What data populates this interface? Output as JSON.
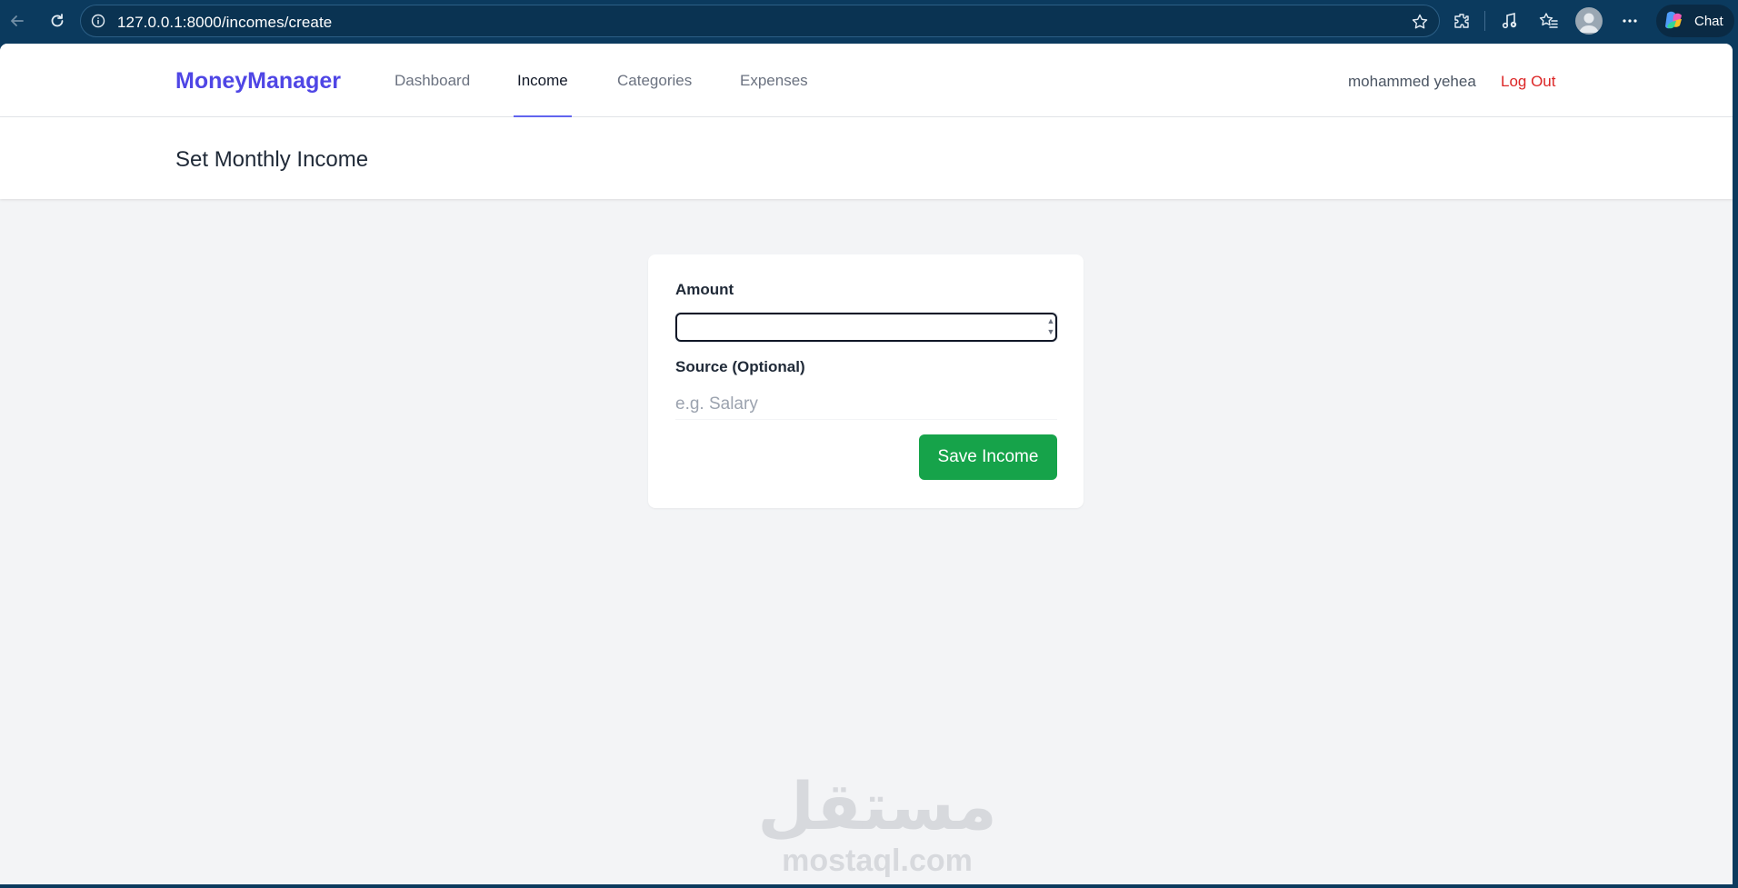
{
  "browser": {
    "url": "127.0.0.1:8000/incomes/create",
    "chat_label": "Chat",
    "icons": {
      "back": "arrow-left-icon",
      "reload": "reload-icon",
      "site_info": "info-icon",
      "favorite": "star-icon",
      "extensions": "puzzle-icon",
      "media": "music-note-icon",
      "favorites": "star-list-icon",
      "profile": "avatar",
      "more": "ellipsis-icon",
      "chat": "copilot-icon"
    }
  },
  "nav": {
    "brand": "MoneyManager",
    "links": {
      "dashboard": "Dashboard",
      "income": "Income",
      "categories": "Categories",
      "expenses": "Expenses"
    },
    "active": "Income",
    "user_name": "mohammed yehea",
    "logout": "Log Out"
  },
  "page": {
    "title": "Set Monthly Income"
  },
  "form": {
    "amount_label": "Amount",
    "amount_value": "",
    "source_label": "Source (Optional)",
    "source_placeholder": "e.g. Salary",
    "source_value": "",
    "submit_label": "Save Income"
  },
  "watermark": {
    "arabic": "مستقل",
    "latin": "mostaql.com"
  },
  "colors": {
    "brand": "#4f46e5",
    "logout": "#dc2626",
    "save_button": "#16a34a",
    "page_bg": "#f3f4f6",
    "browser_bg": "#0b3a5e"
  }
}
